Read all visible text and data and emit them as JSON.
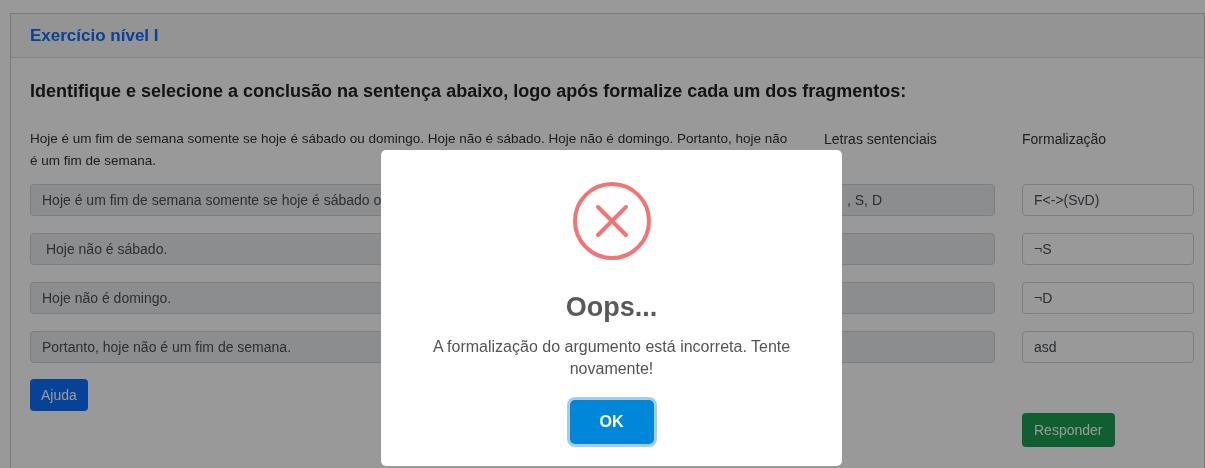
{
  "card": {
    "title": "Exercício nível I"
  },
  "instruction": "Identifique e selecione a conclusão na sentença abaixo, logo após formalize cada um dos fragmentos:",
  "sentence": "Hoje é um fim de semana somente se hoje é sábado ou domingo. Hoje não é sábado. Hoje não é domingo. Portanto, hoje não é um fim de semana.",
  "columns": [
    "Letras sentenciais",
    "Formalização"
  ],
  "rows": [
    {
      "fragment": "Hoje é um fim de semana somente se hoje é sábado o",
      "letters": ", S, D",
      "formalization": "F<->(SvD)"
    },
    {
      "fragment": " Hoje não é sábado.",
      "formalization": "¬S"
    },
    {
      "fragment": "Hoje não é domingo.",
      "formalization": "¬D"
    },
    {
      "fragment": "Portanto, hoje não é um fim de semana.",
      "formalization": "asd"
    }
  ],
  "help_button": "Ajuda",
  "submit_button": "Responder",
  "dialog": {
    "kind": "error",
    "title": "Oops...",
    "message": "A formalização do argumento está incorreta. Tente novamente!",
    "confirm_button": "OK"
  }
}
